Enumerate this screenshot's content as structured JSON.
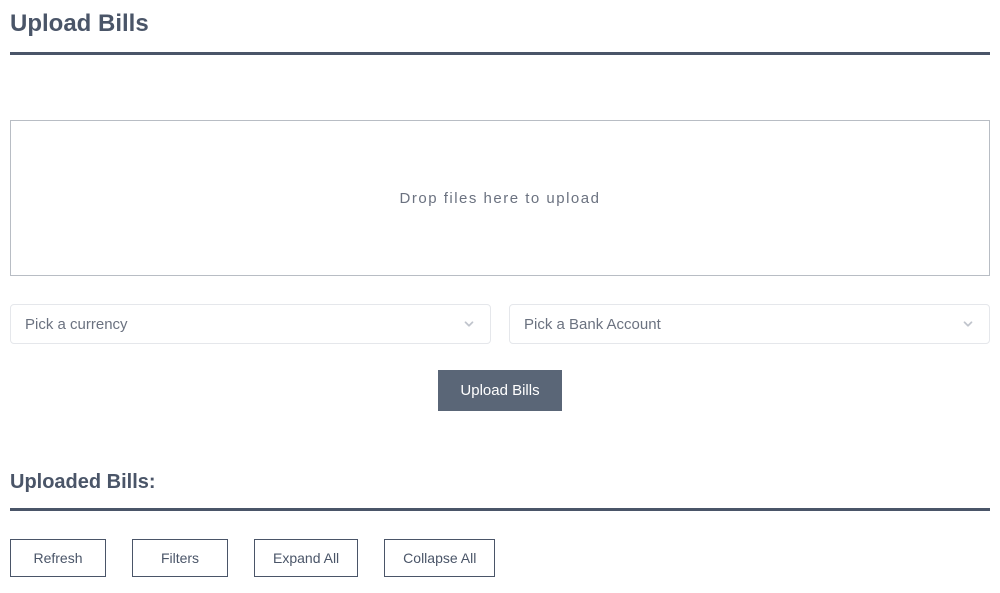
{
  "page": {
    "title": "Upload Bills"
  },
  "dropzone": {
    "text": "Drop files here to upload"
  },
  "selects": {
    "currency": {
      "placeholder": "Pick a currency"
    },
    "bankAccount": {
      "placeholder": "Pick a Bank Account"
    }
  },
  "buttons": {
    "upload": "Upload Bills"
  },
  "uploaded": {
    "title": "Uploaded Bills:"
  },
  "actions": {
    "refresh": "Refresh",
    "filters": "Filters",
    "expandAll": "Expand All",
    "collapseAll": "Collapse All"
  }
}
